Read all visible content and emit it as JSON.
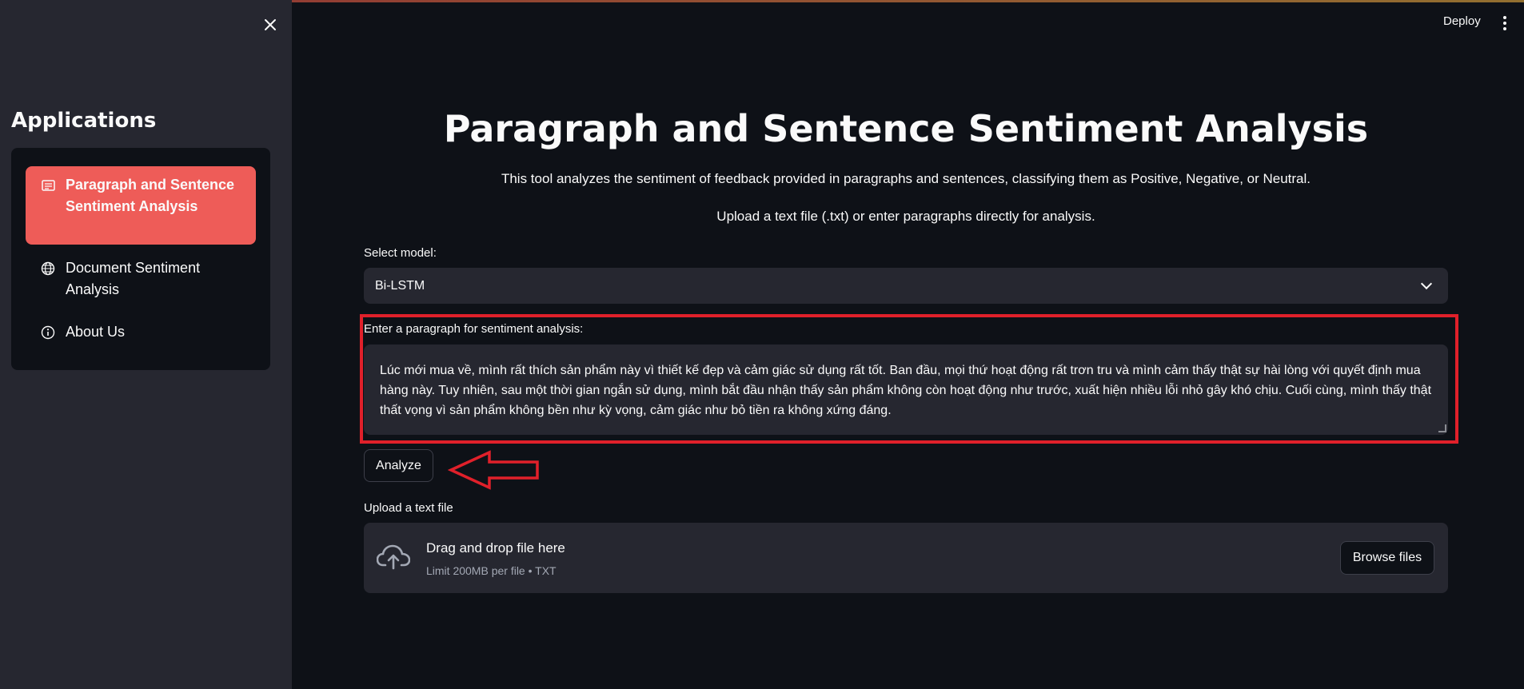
{
  "header": {
    "deploy_label": "Deploy"
  },
  "sidebar": {
    "title": "Applications",
    "items": [
      {
        "label": "Paragraph and Sentence Sentiment Analysis",
        "icon": "document-icon",
        "active": true
      },
      {
        "label": "Document Sentiment Analysis",
        "icon": "globe-icon",
        "active": false
      },
      {
        "label": "About Us",
        "icon": "info-icon",
        "active": false
      }
    ]
  },
  "main": {
    "title": "Paragraph and Sentence Sentiment Analysis",
    "description": "This tool analyzes the sentiment of feedback provided in paragraphs and sentences, classifying them as Positive, Negative, or Neutral.",
    "instruction": "Upload a text file (.txt) or enter paragraphs directly for analysis.",
    "model": {
      "label": "Select model:",
      "selected": "Bi-LSTM"
    },
    "paragraph": {
      "label": "Enter a paragraph for sentiment analysis:",
      "value": "Lúc mới mua về, mình rất thích sản phẩm này vì thiết kế đẹp và cảm giác sử dụng rất tốt. Ban đầu, mọi thứ hoạt động rất trơn tru và mình cảm thấy thật sự hài lòng với quyết định mua hàng này. Tuy nhiên, sau một thời gian ngắn sử dụng, mình bắt đầu nhận thấy sản phẩm không còn hoạt động như trước, xuất hiện nhiều lỗi nhỏ gây khó chịu. Cuối cùng, mình thấy thật thất vọng vì sản phẩm không bền như kỳ vọng, cảm giác như bỏ tiền ra không xứng đáng."
    },
    "analyze_label": "Analyze",
    "upload": {
      "label": "Upload a text file",
      "title": "Drag and drop file here",
      "subtitle": "Limit 200MB per file • TXT",
      "browse_label": "Browse files"
    }
  },
  "colors": {
    "background": "#0e1117",
    "sidebar": "#262730",
    "accent": "#ee5c58",
    "highlight": "#e0202a"
  }
}
